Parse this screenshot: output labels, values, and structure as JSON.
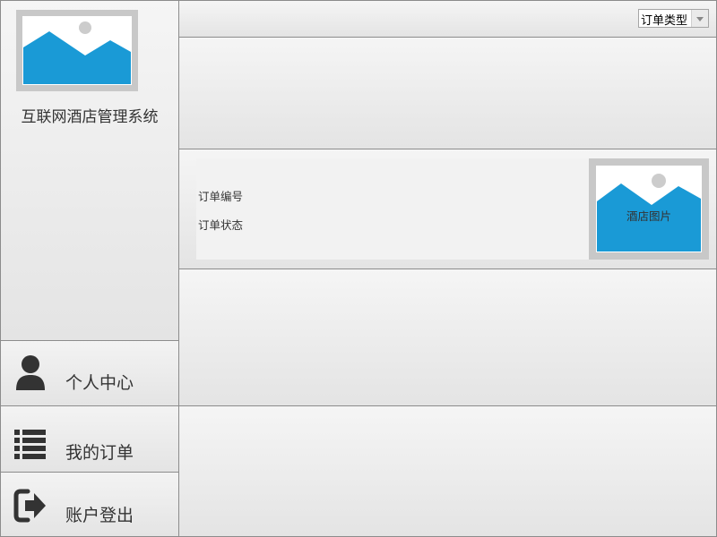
{
  "app": {
    "title": "互联网酒店管理系统"
  },
  "sidebar": {
    "nav": [
      {
        "label": "个人中心",
        "icon": "user-icon"
      },
      {
        "label": "我的订单",
        "icon": "list-icon"
      },
      {
        "label": "账户登出",
        "icon": "logout-icon"
      }
    ]
  },
  "header": {
    "order_type_select": {
      "value": "订单类型"
    }
  },
  "order_card": {
    "order_number_label": "订单编号",
    "order_status_label": "订单状态",
    "hotel_image_label": "酒店图片"
  },
  "colors": {
    "image_sky": "#ffffff",
    "image_mountain": "#1a9ad6",
    "image_frame": "#c8c8c8",
    "image_sun": "#cccccc",
    "icon_dark": "#333333"
  }
}
